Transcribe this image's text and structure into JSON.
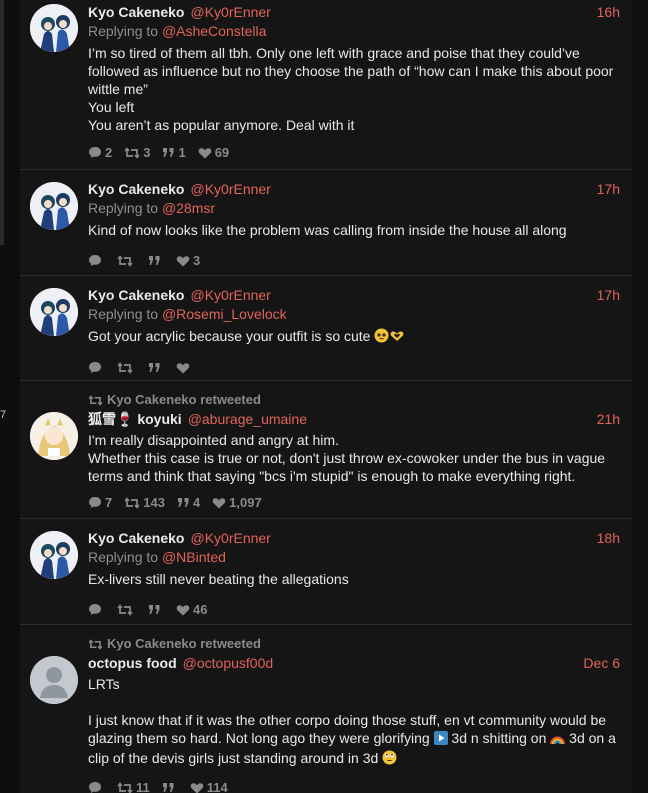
{
  "gutter_mark": "7",
  "icons": {
    "reply": "speech-bubble-icon",
    "retweet": "retweet-arrows-icon",
    "quote": "quote-marks-icon",
    "like": "heart-icon"
  },
  "colors": {
    "accent": "#e2635a",
    "muted": "#8a8a8a"
  },
  "tweets": [
    {
      "name": "Kyo Cakeneko",
      "handle": "@Ky0rEnner",
      "time": "16h",
      "reply_prefix": "Replying to",
      "reply_to": "@AsheConstella",
      "lines": [
        "I’m so tired of them all tbh. Only one left with grace and poise that they could’ve followed as influence but no they choose the path of “how can I make this about poor wittle me”",
        "You left",
        "You aren’t as popular anymore. Deal with it"
      ],
      "stats": {
        "replies": "2",
        "retweets": "3",
        "quotes": "1",
        "likes": "69"
      }
    },
    {
      "name": "Kyo Cakeneko",
      "handle": "@Ky0rEnner",
      "time": "17h",
      "reply_prefix": "Replying to",
      "reply_to": "@28msr",
      "lines": [
        "Kind of now looks like the problem was calling from inside the house all along"
      ],
      "stats": {
        "replies": "",
        "retweets": "",
        "quotes": "",
        "likes": "3"
      }
    },
    {
      "name": "Kyo Cakeneko",
      "handle": "@Ky0rEnner",
      "time": "17h",
      "reply_prefix": "Replying to",
      "reply_to": "@Rosemi_Lovelock",
      "lines": [
        "Got your acrylic because your outfit is so cute"
      ],
      "stats": {
        "replies": "",
        "retweets": "",
        "quotes": "",
        "likes": ""
      }
    },
    {
      "retweeted_by": "Kyo Cakeneko retweeted",
      "name": "狐雪🍷 koyuki",
      "handle": "@aburage_umaine",
      "time": "21h",
      "lines": [
        "I'm really disappointed and angry at him.",
        "Whether this case is true or not, don't just throw ex-cowoker under the bus in vague terms and think that saying \"bcs i'm stupid\" is enough to make everything right."
      ],
      "stats": {
        "replies": "7",
        "retweets": "143",
        "quotes": "4",
        "likes": "1,097"
      }
    },
    {
      "name": "Kyo Cakeneko",
      "handle": "@Ky0rEnner",
      "time": "18h",
      "reply_prefix": "Replying to",
      "reply_to": "@NBinted",
      "lines": [
        "Ex-livers still never beating the allegations"
      ],
      "stats": {
        "replies": "",
        "retweets": "",
        "quotes": "",
        "likes": "46"
      }
    },
    {
      "retweeted_by": "Kyo Cakeneko retweeted",
      "name": "octopus food",
      "handle": "@octopusf00d",
      "time": "Dec 6",
      "lines": [
        "LRTs",
        "",
        "I just know that if it was the other corpo doing those stuff, en vt community would be glazing them so hard. Not long ago they were glorifying",
        "3d n shitting on",
        "3d on a clip of the devis girls just standing around in 3d"
      ],
      "stats": {
        "replies": "",
        "retweets": "11",
        "quotes": "",
        "likes": "114"
      }
    }
  ]
}
